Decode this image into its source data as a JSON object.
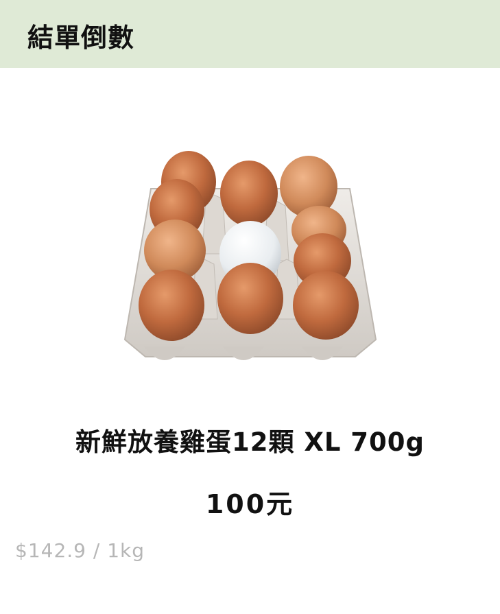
{
  "header": {
    "title": "結單倒數"
  },
  "product": {
    "image_icon": "egg-carton-icon",
    "name": "新鮮放養雞蛋12顆 XL 700g",
    "price": "100元",
    "unit_price": "$142.9 / 1kg"
  },
  "colors": {
    "header_bg": "#dfead6",
    "unit_price_text": "#b6b6b6"
  }
}
